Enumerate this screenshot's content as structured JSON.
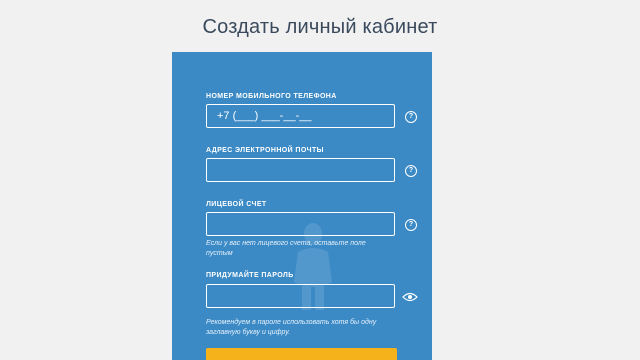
{
  "page": {
    "title": "Создать личный кабинет"
  },
  "form": {
    "phone": {
      "label": "НОМЕР МОБИЛЬНОГО ТЕЛЕФОНА",
      "value": "+7 (___) ___-__-__",
      "help": "?"
    },
    "email": {
      "label": "АДРЕС ЭЛЕКТРОННОЙ ПОЧТЫ",
      "value": "",
      "help": "?"
    },
    "account": {
      "label": "ЛИЦЕВОЙ СЧЕТ",
      "value": "",
      "help": "?",
      "hint": "Если у вас нет лицевого счета, оставьте поле пустым"
    },
    "password": {
      "label": "ПРИДУМАЙТЕ ПАРОЛЬ",
      "value": "",
      "hint": "Рекомендуем в пароле использовать хотя бы одну заглавную букву и цифру.",
      "toggle_icon": "eye-icon"
    },
    "submit_label": ""
  },
  "colors": {
    "background": "#f1f1f1",
    "card": "#3b8ac6",
    "accent_button": "#f6b21b",
    "title": "#3a4a5c"
  }
}
